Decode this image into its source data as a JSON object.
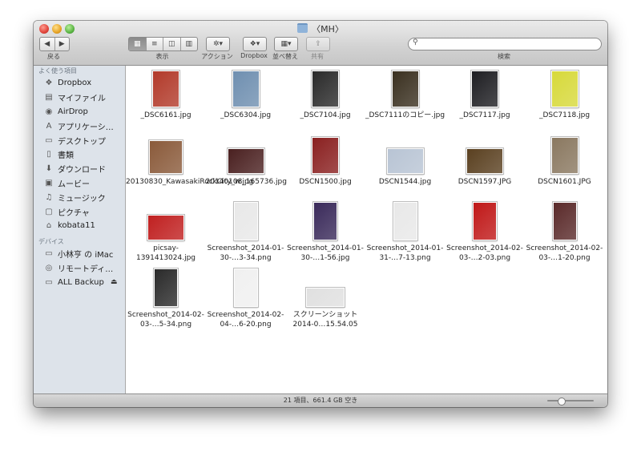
{
  "window": {
    "title": "〈MH〉"
  },
  "toolbar": {
    "back_label": "戻る",
    "view_label": "表示",
    "action_label": "アクション",
    "dropbox_label": "Dropbox",
    "arrange_label": "並べ替え",
    "share_label": "共有",
    "search_label": "検索",
    "search_placeholder": ""
  },
  "sidebar": {
    "favorites_header": "よく使う項目",
    "favorites": [
      {
        "label": "Dropbox",
        "icon": "dropbox-icon"
      },
      {
        "label": "マイファイル",
        "icon": "all-files-icon"
      },
      {
        "label": "AirDrop",
        "icon": "airdrop-icon"
      },
      {
        "label": "アプリケーシ…",
        "icon": "applications-icon"
      },
      {
        "label": "デスクトップ",
        "icon": "desktop-icon"
      },
      {
        "label": "書類",
        "icon": "documents-icon"
      },
      {
        "label": "ダウンロード",
        "icon": "downloads-icon"
      },
      {
        "label": "ムービー",
        "icon": "movies-icon"
      },
      {
        "label": "ミュージック",
        "icon": "music-icon"
      },
      {
        "label": "ピクチャ",
        "icon": "pictures-icon"
      },
      {
        "label": "kobata11",
        "icon": "home-icon"
      }
    ],
    "devices_header": "デバイス",
    "devices": [
      {
        "label": "小林亨 の iMac",
        "icon": "imac-icon"
      },
      {
        "label": "リモートディ…",
        "icon": "remote-disc-icon"
      },
      {
        "label": "ALL Backup",
        "icon": "drive-icon",
        "eject": "⏏"
      }
    ]
  },
  "files": [
    {
      "name": "_DSC6161.jpg",
      "color": "#b23a2a",
      "orient": "portrait"
    },
    {
      "name": "_DSC6304.jpg",
      "color": "#6f8fb0",
      "orient": "portrait"
    },
    {
      "name": "_DSC7104.jpg",
      "color": "#2a2a2a",
      "orient": "portrait"
    },
    {
      "name": "_DSC7111のコピー.jpg",
      "color": "#3a3020",
      "orient": "portrait"
    },
    {
      "name": "_DSC7117.jpg",
      "color": "#1e1e22",
      "orient": "portrait"
    },
    {
      "name": "_DSC7118.jpg",
      "color": "#d7d93a",
      "orient": "portrait"
    },
    {
      "name": "20130830_KawasakiRockCity_w.jpg",
      "color": "#8a5a3a",
      "orient": "square"
    },
    {
      "name": "20140108_165736.jpg",
      "color": "#4a2020",
      "orient": "landscape"
    },
    {
      "name": "DSCN1500.jpg",
      "color": "#8a2020",
      "orient": "portrait"
    },
    {
      "name": "DSCN1544.jpg",
      "color": "#b8c4d4",
      "orient": "landscape"
    },
    {
      "name": "DSCN1597.JPG",
      "color": "#5a4020",
      "orient": "landscape"
    },
    {
      "name": "DSCN1601.JPG",
      "color": "#8a7860",
      "orient": "portrait"
    },
    {
      "name": "picsay-1391413024.jpg",
      "color": "#c02020",
      "orient": "landscape"
    },
    {
      "name": "Screenshot_2014-01-30-…3-34.png",
      "color": "#e8e8e8",
      "orient": "phone"
    },
    {
      "name": "Screenshot_2014-01-30-…1-56.jpg",
      "color": "#3a2a5a",
      "orient": "phone"
    },
    {
      "name": "Screenshot_2014-01-31-…7-13.png",
      "color": "#e8e8e8",
      "orient": "phone"
    },
    {
      "name": "Screenshot_2014-02-03-…2-03.png",
      "color": "#c01818",
      "orient": "phone"
    },
    {
      "name": "Screenshot_2014-02-03-…1-20.png",
      "color": "#5a2a2a",
      "orient": "phone"
    },
    {
      "name": "Screenshot_2014-02-03-…5-34.png",
      "color": "#2a2a2a",
      "orient": "phone"
    },
    {
      "name": "Screenshot_2014-02-04-…6-20.png",
      "color": "#f0f0f0",
      "orient": "phone"
    },
    {
      "name": "スクリーンショット2014-0…15.54.05",
      "color": "#e0e0e0",
      "orient": "wide"
    }
  ],
  "status": {
    "text": "21 項目、661.4 GB 空き",
    "icon_size_fraction": 0.25
  }
}
